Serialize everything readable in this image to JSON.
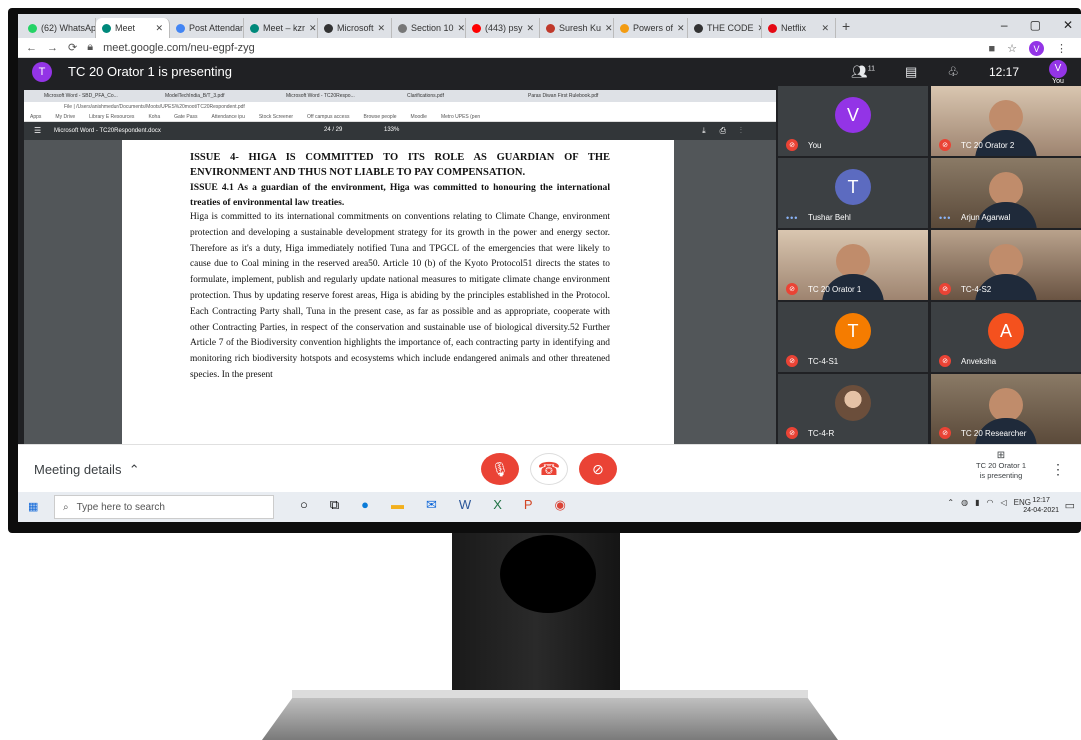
{
  "browser": {
    "tabs": [
      {
        "label": "(62) WhatsApp",
        "color": "#25d366",
        "active": false
      },
      {
        "label": "Meet",
        "color": "#00897b",
        "active": true
      },
      {
        "label": "Post Attendance",
        "color": "#4285f4",
        "active": false
      },
      {
        "label": "Meet – kzr",
        "color": "#00897b",
        "active": false
      },
      {
        "label": "Microsoft",
        "color": "#333333",
        "active": false
      },
      {
        "label": "Section 10",
        "color": "#777777",
        "active": false
      },
      {
        "label": "(443) psy",
        "color": "#ff0000",
        "active": false
      },
      {
        "label": "Suresh Ku",
        "color": "#c0392b",
        "active": false
      },
      {
        "label": "Powers of",
        "color": "#f39c12",
        "active": false
      },
      {
        "label": "THE CODE",
        "color": "#333333",
        "active": false
      },
      {
        "label": "Netflix",
        "color": "#e50914",
        "active": false
      }
    ],
    "new_tab": "+",
    "url": "meet.google.com/neu-egpf-zyg",
    "profile_initial": "V"
  },
  "meet": {
    "presenter_initial": "T",
    "presenting_text": "TC 20 Orator 1 is presenting",
    "participant_count": "11",
    "time": "12:17",
    "you_label": "You",
    "you_initial": "V"
  },
  "shared": {
    "inner_tabs": [
      "Microsoft Word - SBD_PFA_Co...",
      "ModelTechIndia_B/T_3.pdf",
      "Microsoft Word - TC20Respo...",
      "Clarifications.pdf",
      "Paras Diwan First Rulebook.pdf"
    ],
    "inner_url": "File | /Users/anishmedur/Documents/Moots/UPES%20moot/TC20Respondent.pdf",
    "bookmarks": [
      "Apps",
      "My Drive",
      "Library E Resources",
      "Koha",
      "Gate Pass",
      "Attendance ipu",
      "Stock Screener",
      "Off campus access",
      "Browse people",
      "Moodle",
      "Metro UPES (pen"
    ],
    "pdf_title": "Microsoft Word - TC20Respondent.docx",
    "pdf_page": "24 / 29",
    "pdf_zoom": "133%",
    "heading1": "ISSUE 4- HIGA IS COMMITTED TO ITS ROLE AS GUARDIAN OF THE ENVIRONMENT AND THUS NOT LIABLE TO PAY COMPENSATION.",
    "heading2": "ISSUE 4.1 As a guardian of the environment, Higa was committed to honouring the international treaties of environmental law treaties.",
    "body": "Higa is committed to its international commitments on conventions relating to Climate Change, environment protection and developing a sustainable development strategy for its growth in the power and energy sector. Therefore as it's a duty, Higa immediately notified Tuna and TPGCL of the emergencies that were likely to cause due to Coal mining in the reserved area50. Article 10 (b) of the Kyoto Protocol51 directs the states to formulate, implement, publish and regularly update national measures to mitigate climate change environment protection. Thus by updating reserve forest areas, Higa is abiding by the principles established in the Protocol. Each Contracting Party shall, Tuna in the present case, as far as possible and as appropriate, cooperate with other Contracting Parties, in respect of the conservation and sustainable use of biological diversity.52 Further Article 7 of the Biodiversity convention highlights the importance of, each contracting party in identifying and monitoring rich biodiversity hotspots and ecosystems which include endangered animals and other threatened species. In the present"
  },
  "participants": [
    {
      "name": "You",
      "initial": "V",
      "color": "#9334e6",
      "video": false,
      "status": "muted"
    },
    {
      "name": "TC 20 Orator 2",
      "initial": "",
      "color": "",
      "video": true,
      "status": "active"
    },
    {
      "name": "Tushar Behl",
      "initial": "T",
      "color": "#5c6bc0",
      "video": false,
      "status": "speaking"
    },
    {
      "name": "Arjun Agarwal",
      "initial": "",
      "color": "",
      "video": true,
      "status": "speaking"
    },
    {
      "name": "TC 20 Orator 1",
      "initial": "",
      "color": "",
      "video": true,
      "status": "muted"
    },
    {
      "name": "TC-4-S2",
      "initial": "",
      "color": "",
      "video": true,
      "status": "muted"
    },
    {
      "name": "TC-4-S1",
      "initial": "T",
      "color": "#f57c00",
      "video": false,
      "status": "muted"
    },
    {
      "name": "Anveksha",
      "initial": "A",
      "color": "#f4511e",
      "video": false,
      "status": "muted"
    },
    {
      "name": "TC-4-R",
      "initial": "",
      "color": "#3c4043",
      "video": false,
      "status": "muted"
    },
    {
      "name": "TC 20 Researcher",
      "initial": "",
      "color": "",
      "video": true,
      "status": "muted"
    }
  ],
  "controls": {
    "meeting_details": "Meeting details",
    "presenting_chip_line1": "TC 20 Orator 1",
    "presenting_chip_line2": "is presenting"
  },
  "taskbar": {
    "search_placeholder": "Type here to search",
    "lang": "ENG",
    "time": "12:17",
    "date": "24-04-2021"
  }
}
